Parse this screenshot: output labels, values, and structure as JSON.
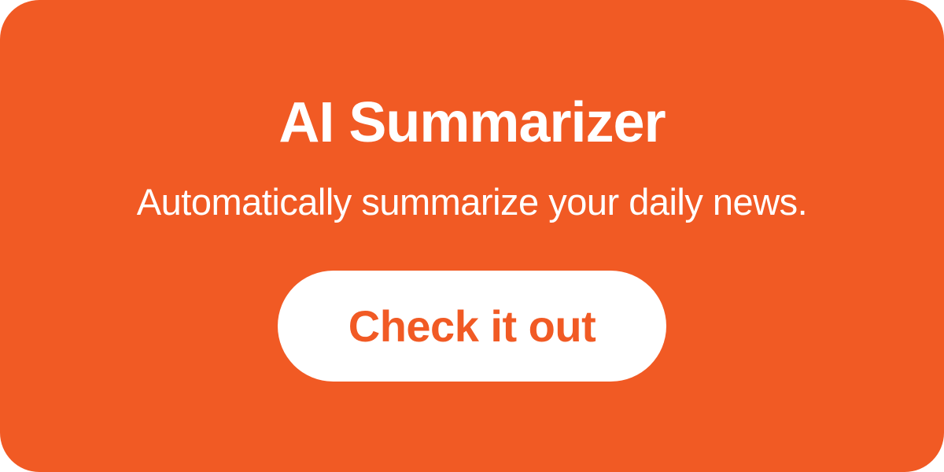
{
  "promo": {
    "title": "AI Summarizer",
    "subtitle": "Automatically summarize your daily news.",
    "cta_label": "Check it out"
  },
  "colors": {
    "accent": "#f15a24",
    "text_on_accent": "#ffffff"
  }
}
